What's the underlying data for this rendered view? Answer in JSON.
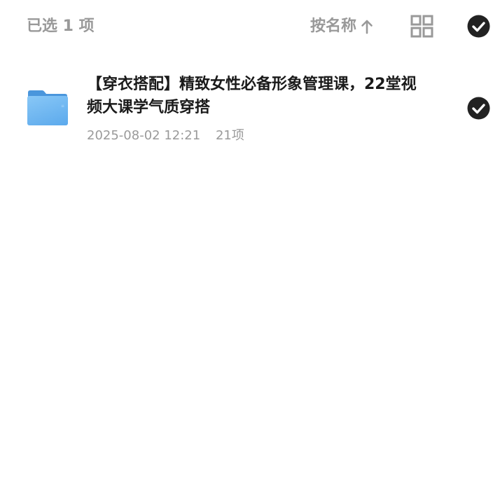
{
  "toolbar": {
    "selected_label": "已选 1 项",
    "sort_label": "按名称",
    "sort_direction_icon": "arrow-up-icon",
    "view_toggle_icon": "grid-view-icon",
    "select_all_icon": "check-circle-icon",
    "select_all_checked": true
  },
  "files": [
    {
      "type": "folder",
      "icon": "folder-icon",
      "name": "【穿衣搭配】精致女性必备形象管理课，22堂视频大课学气质穿搭",
      "date": "2025-08-02 12:21",
      "count": "21项",
      "selected": true,
      "check_icon": "check-circle-icon"
    }
  ],
  "colors": {
    "muted_text": "#999999",
    "primary_text": "#1a1a1a",
    "check_fill": "#222222",
    "folder_blue": "#5aa9ec"
  }
}
